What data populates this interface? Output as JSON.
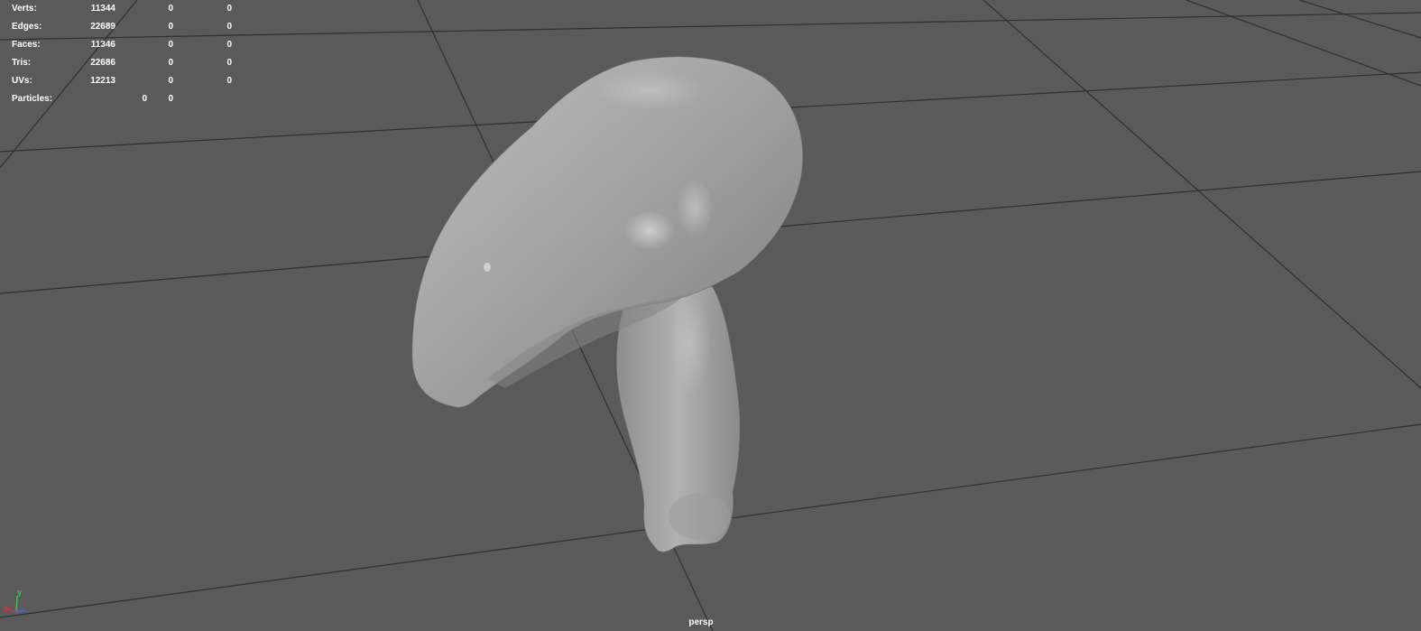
{
  "viewport": {
    "camera_name": "persp",
    "background_color": "#5a5a5a",
    "grid_color": "#2e2e2e",
    "model_color": "#a9a9a9"
  },
  "hud": {
    "rows": [
      {
        "label": "Verts:",
        "values": [
          "11344",
          "0",
          "0"
        ]
      },
      {
        "label": "Edges:",
        "values": [
          "22689",
          "0",
          "0"
        ]
      },
      {
        "label": "Faces:",
        "values": [
          "11346",
          "0",
          "0"
        ]
      },
      {
        "label": "Tris:",
        "values": [
          "22686",
          "0",
          "0"
        ]
      },
      {
        "label": "UVs:",
        "values": [
          "12213",
          "0",
          "0"
        ]
      }
    ],
    "particles": {
      "label": "Particles:",
      "values": [
        "0",
        "0"
      ]
    }
  },
  "axis_gizmo": {
    "y_label": "y",
    "x_label": "x",
    "y_color": "#33cc33",
    "x_color": "#e03030",
    "z_color": "#3a6bff"
  }
}
